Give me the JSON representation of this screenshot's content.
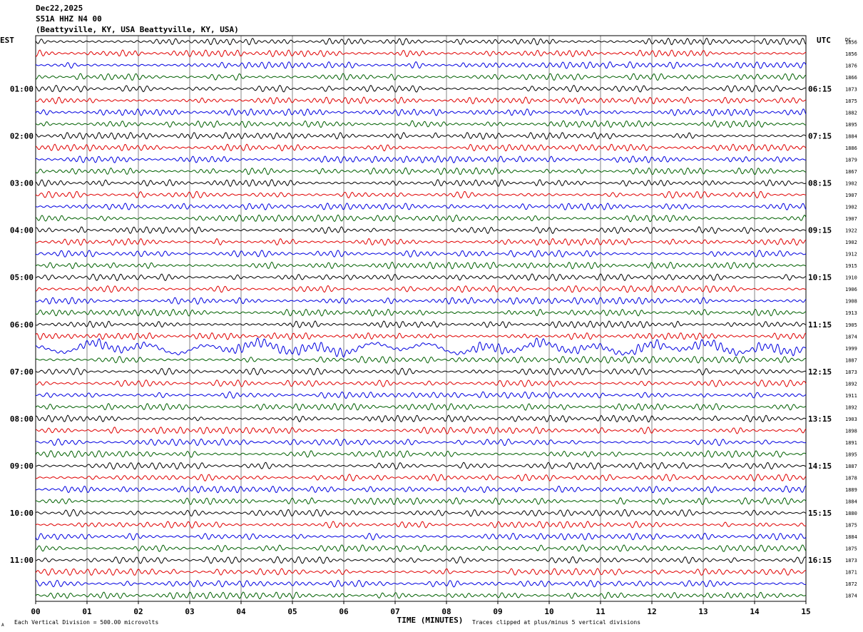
{
  "header": {
    "date": "Dec22,2025",
    "channel": "S51A HHZ N4 00",
    "location": "(Beattyville, KY, USA Beattyville, KY, USA)"
  },
  "labels": {
    "left_tz": "EST",
    "right_tz": "UTC",
    "right_col": "DC",
    "xlabel": "TIME (MINUTES)",
    "footer_left": "Each Vertical Division =  500.00 microvolts",
    "footer_right": "Traces clipped at plus/minus 5 vertical divisions",
    "corner_mark": "A"
  },
  "chart_data": {
    "type": "line",
    "title": "S51A HHZ N4 00",
    "xlabel": "TIME (MINUTES)",
    "x_ticks": [
      "00",
      "01",
      "02",
      "03",
      "04",
      "05",
      "06",
      "07",
      "08",
      "09",
      "10",
      "11",
      "12",
      "13",
      "14",
      "15"
    ],
    "xlim": [
      0,
      15
    ],
    "grid": true,
    "trace_colors": [
      "#000000",
      "#e00000",
      "#0000e0",
      "#006000"
    ],
    "left_hour_labels": [
      "01:00",
      "02:00",
      "03:00",
      "04:00",
      "05:00",
      "06:00",
      "07:00",
      "08:00",
      "09:00",
      "10:00",
      "11:00"
    ],
    "right_hour_labels": [
      "06:15",
      "07:15",
      "08:15",
      "09:15",
      "10:15",
      "11:15",
      "12:15",
      "13:15",
      "14:15",
      "15:15",
      "16:15"
    ],
    "dc_offsets": [
      1856,
      1856,
      1876,
      1866,
      1873,
      1875,
      1882,
      1895,
      1884,
      1886,
      1879,
      1867,
      1902,
      1907,
      1902,
      1907,
      1922,
      1902,
      1912,
      1915,
      1910,
      1906,
      1908,
      1913,
      1905,
      1874,
      1999,
      1887,
      1873,
      1892,
      1911,
      1892,
      1903,
      1898,
      1891,
      1895,
      1887,
      1878,
      1889,
      1884,
      1880,
      1875,
      1884,
      1875,
      1873,
      1871,
      1872,
      1874
    ],
    "noisy_trace_index": 26
  }
}
